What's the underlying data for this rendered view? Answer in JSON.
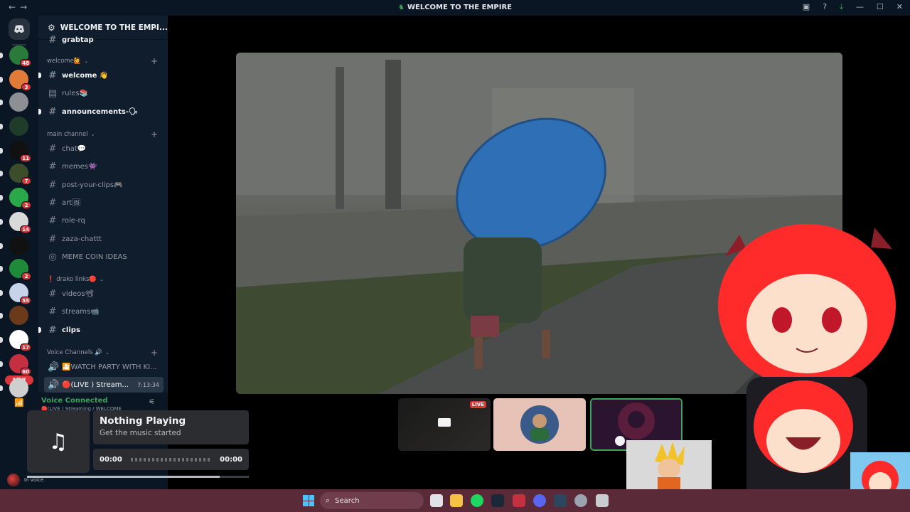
{
  "window": {
    "title": "WELCOME TO THE EMPIRE",
    "nav_back": "←",
    "nav_forward": "→"
  },
  "rail": {
    "badges": [
      "48",
      "3",
      "",
      "",
      "11",
      "7",
      "2",
      "14",
      "",
      "2",
      "55",
      "",
      "17",
      "60"
    ],
    "new_label": "NEW"
  },
  "guild": {
    "name": "WELCOME TO THE EMPI..."
  },
  "sidebar": {
    "top_cut_channel": "grabtap",
    "categories": [
      {
        "label": "welcome🙋",
        "channels": [
          "welcome 👋",
          "rules📚",
          "announcements-🗣"
        ]
      },
      {
        "label": "main channel",
        "channels": [
          "chat💬",
          "memes👾",
          "post-your-clips🎮",
          "art🖼",
          "role-rq",
          "zaza-chattt",
          "MEME COIN IDEAS"
        ]
      },
      {
        "label": "❗ drako links🔴",
        "channels": [
          "videos📽",
          "streams📹",
          "clips"
        ]
      },
      {
        "label": "Voice Channels 🔊",
        "channels": [
          "🎦WATCH PARTY WITH KI...",
          "🔴(LIVE ) Stream..."
        ]
      }
    ],
    "active_timer": "7:13:34"
  },
  "voice": {
    "status": "Voice Connected",
    "sub": "🔴(LIVE ) Streaming / WELCOME",
    "user_status": "In voice"
  },
  "now_playing": {
    "title": "Nothing Playing",
    "subtitle": "Get the music started",
    "elapsed": "00:00",
    "total": "00:00",
    "music_icon": "♫",
    "scrub_fraction": 0.87
  },
  "stream_tiles": {
    "live_label": "LIVE"
  },
  "taskbar": {
    "search_label": "Search"
  },
  "colors": {
    "accent_green": "#3ba55d",
    "badge_red": "#da373c",
    "sidebar_bg": "#0f1d2d",
    "taskbar_bg": "#5a2a38"
  }
}
